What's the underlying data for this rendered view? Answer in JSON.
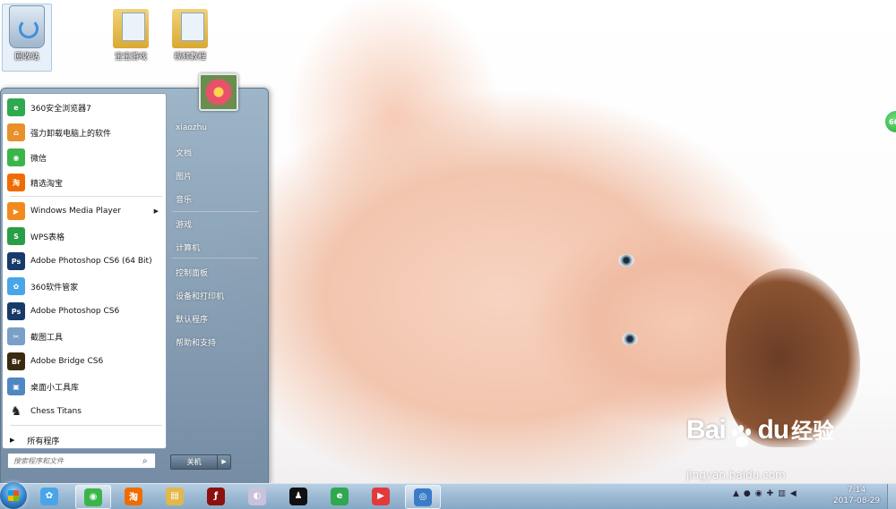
{
  "desktop": {
    "icons": [
      {
        "label": "回收站",
        "name": "recycle-bin"
      },
      {
        "label": "宝宝游戏",
        "name": "folder-1"
      },
      {
        "label": "视频教程",
        "name": "folder-2"
      }
    ]
  },
  "start_menu": {
    "programs": [
      {
        "label": "360安全浏览器7",
        "icon": "browser-360-icon",
        "color": "#2fa84f",
        "glyph": "e"
      },
      {
        "label": "强力卸载电脑上的软件",
        "icon": "uninstall-icon",
        "color": "#e7902c",
        "glyph": "⌂"
      },
      {
        "label": "微信",
        "icon": "wechat-icon",
        "color": "#3bb54a",
        "glyph": "◉"
      },
      {
        "label": "精选淘宝",
        "icon": "taobao-icon",
        "color": "#f06c00",
        "glyph": "淘"
      },
      {
        "label": "Windows Media Player",
        "icon": "media-player-icon",
        "color": "#f08a1c",
        "glyph": "▶",
        "has_submenu": true
      },
      {
        "label": "WPS表格",
        "icon": "wps-sheet-icon",
        "color": "#2a9d47",
        "glyph": "S"
      },
      {
        "label": "Adobe Photoshop CS6 (64 Bit)",
        "icon": "photoshop-icon",
        "color": "#173a6a",
        "glyph": "Ps"
      },
      {
        "label": "360软件管家",
        "icon": "software-manager-icon",
        "color": "#4aa5e8",
        "glyph": "✿"
      },
      {
        "label": "Adobe Photoshop CS6",
        "icon": "photoshop-icon",
        "color": "#173a6a",
        "glyph": "Ps"
      },
      {
        "label": "截图工具",
        "icon": "snipping-tool-icon",
        "color": "#7aa0c9",
        "glyph": "✂"
      },
      {
        "label": "Adobe Bridge CS6",
        "icon": "bridge-icon",
        "color": "#3a2a10",
        "glyph": "Br"
      },
      {
        "label": "桌面小工具库",
        "icon": "gadgets-icon",
        "color": "#4f87c3",
        "glyph": "▣"
      },
      {
        "label": "Chess Titans",
        "icon": "chess-icon",
        "color": "#ffffff",
        "glyph": "♞"
      }
    ],
    "all_programs": "所有程序",
    "search_placeholder": "搜索程序和文件",
    "user_name": "xiaozhu",
    "right_items": [
      {
        "label": "文档",
        "name": "documents"
      },
      {
        "label": "图片",
        "name": "pictures"
      },
      {
        "label": "音乐",
        "name": "music"
      },
      {
        "label": "游戏",
        "name": "games"
      },
      {
        "label": "计算机",
        "name": "computer"
      },
      {
        "label": "控制面板",
        "name": "control-panel"
      },
      {
        "label": "设备和打印机",
        "name": "devices-printers"
      },
      {
        "label": "默认程序",
        "name": "default-programs"
      },
      {
        "label": "帮助和支持",
        "name": "help-support"
      }
    ],
    "shutdown_label": "关机"
  },
  "taskbar": {
    "buttons": [
      {
        "name": "taskbar-360-manager",
        "icon": "software-manager-icon",
        "color": "#4aa5e8",
        "glyph": "✿"
      },
      {
        "name": "taskbar-wechat",
        "icon": "wechat-icon",
        "color": "#3bb54a",
        "glyph": "◉",
        "active": true
      },
      {
        "name": "taskbar-taobao",
        "icon": "taobao-icon",
        "color": "#f06c00",
        "glyph": "淘"
      },
      {
        "name": "taskbar-explorer",
        "icon": "folder-icon",
        "color": "#e2b84a",
        "glyph": "▤"
      },
      {
        "name": "taskbar-flash",
        "icon": "flash-icon",
        "color": "#8b1010",
        "glyph": "ƒ"
      },
      {
        "name": "taskbar-paint",
        "icon": "paint-icon",
        "color": "#c9c2dc",
        "glyph": "◐"
      },
      {
        "name": "taskbar-qq",
        "icon": "qq-icon",
        "color": "#111111",
        "glyph": "♟"
      },
      {
        "name": "taskbar-360-browser",
        "icon": "browser-360-icon",
        "color": "#2fa84f",
        "glyph": "e"
      },
      {
        "name": "taskbar-media",
        "icon": "media-player-icon",
        "color": "#e23a3a",
        "glyph": "▶"
      },
      {
        "name": "taskbar-network",
        "icon": "network-icon",
        "color": "#3b7cc8",
        "glyph": "◎",
        "active": true
      }
    ],
    "time": "7:14",
    "date": "2017-08-29"
  },
  "side_badge": "66",
  "watermark": {
    "brand_left": "Bai",
    "brand_mid": "du",
    "brand_cn": "经验",
    "url": "jingyan.baidu.com"
  }
}
